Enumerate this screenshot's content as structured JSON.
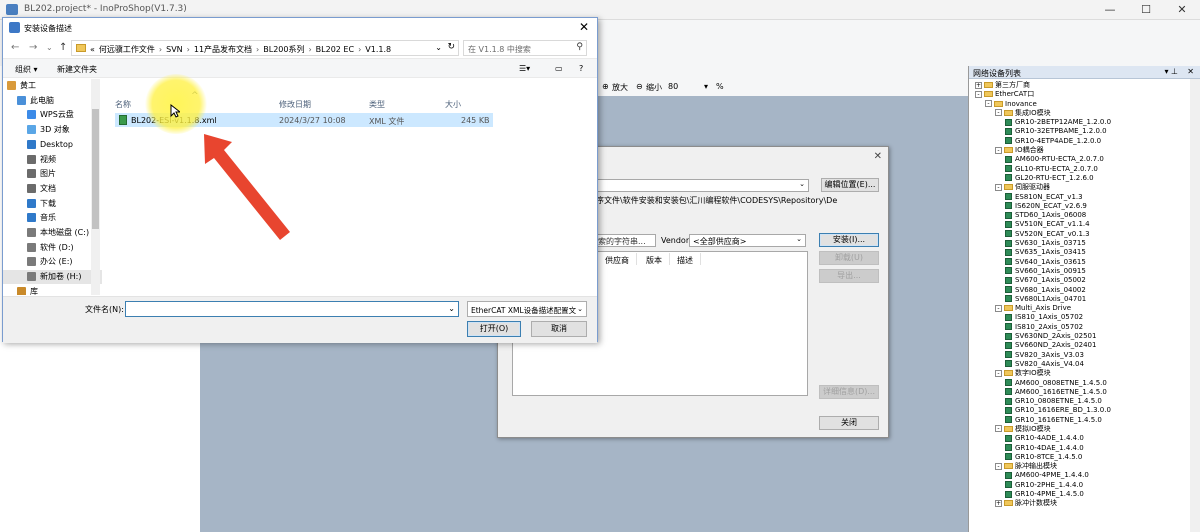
{
  "app": {
    "title": "BL202.project* - InoProShop(V1.7.3)",
    "min": "—",
    "max": "☐",
    "close": "✕"
  },
  "toolbar": {
    "zoom_in": "放大",
    "zoom_out": "缩小",
    "zoom_value": "80",
    "zoom_unit": "%"
  },
  "tree_panel": {
    "title": "网络设备列表",
    "pin": "▾ ⊥",
    "close": "✕",
    "rows": [
      {
        "level": 0,
        "type": "folder",
        "exp": "+",
        "label": "第三方厂商"
      },
      {
        "level": 0,
        "type": "folder",
        "exp": "-",
        "label": "EtherCAT口"
      },
      {
        "level": 1,
        "type": "folder",
        "exp": "-",
        "label": "Inovance"
      },
      {
        "level": 2,
        "type": "folder",
        "exp": "-",
        "label": "集成IO模块"
      },
      {
        "level": 3,
        "type": "device",
        "label": "GR10-2BETP12AME_1.2.0.0"
      },
      {
        "level": 3,
        "type": "device",
        "label": "GR10-32ETPBAME_1.2.0.0"
      },
      {
        "level": 3,
        "type": "device",
        "label": "GR10-4ETP4ADE_1.2.0.0"
      },
      {
        "level": 2,
        "type": "folder",
        "exp": "-",
        "label": "IO耦合器"
      },
      {
        "level": 3,
        "type": "device",
        "label": "AM600-RTU-ECTA_2.0.7.0"
      },
      {
        "level": 3,
        "type": "device",
        "label": "GL10-RTU-ECTA_2.0.7.0"
      },
      {
        "level": 3,
        "type": "device",
        "label": "GL20-RTU-ECT_1.2.6.0"
      },
      {
        "level": 2,
        "type": "folder",
        "exp": "-",
        "label": "伺服驱动器"
      },
      {
        "level": 3,
        "type": "device",
        "label": "ES810N_ECAT_v1.3"
      },
      {
        "level": 3,
        "type": "device",
        "label": "IS620N_ECAT_v2.6.9"
      },
      {
        "level": 3,
        "type": "device",
        "label": "STD60_1Axis_06008"
      },
      {
        "level": 3,
        "type": "device",
        "label": "SV510N_ECAT_v1.1.4"
      },
      {
        "level": 3,
        "type": "device",
        "label": "SV520N_ECAT_v0.1.3"
      },
      {
        "level": 3,
        "type": "device",
        "label": "SV630_1Axis_03715"
      },
      {
        "level": 3,
        "type": "device",
        "label": "SV635_1Axis_03415"
      },
      {
        "level": 3,
        "type": "device",
        "label": "SV640_1Axis_03615"
      },
      {
        "level": 3,
        "type": "device",
        "label": "SV660_1Axis_00915"
      },
      {
        "level": 3,
        "type": "device",
        "label": "SV670_1Axis_05002"
      },
      {
        "level": 3,
        "type": "device",
        "label": "SV680_1Axis_04002"
      },
      {
        "level": 3,
        "type": "device",
        "label": "SV680L1Axis_04701"
      },
      {
        "level": 2,
        "type": "folder",
        "exp": "-",
        "label": "Multi_Axis Drive"
      },
      {
        "level": 3,
        "type": "device",
        "label": "IS810_1Axis_05702"
      },
      {
        "level": 3,
        "type": "device",
        "label": "IS810_2Axis_05702"
      },
      {
        "level": 3,
        "type": "device",
        "label": "SV630ND_2Axis_02501"
      },
      {
        "level": 3,
        "type": "device",
        "label": "SV660ND_2Axis_02401"
      },
      {
        "level": 3,
        "type": "device",
        "label": "SV820_3Axis_V3.03"
      },
      {
        "level": 3,
        "type": "device",
        "label": "SV820_4Axis_V4.04"
      },
      {
        "level": 2,
        "type": "folder",
        "exp": "-",
        "label": "数字IO模块"
      },
      {
        "level": 3,
        "type": "device",
        "label": "AM600_0808ETNE_1.4.5.0"
      },
      {
        "level": 3,
        "type": "device",
        "label": "AM600_1616ETNE_1.4.5.0"
      },
      {
        "level": 3,
        "type": "device",
        "label": "GR10_0808ETNE_1.4.5.0"
      },
      {
        "level": 3,
        "type": "device",
        "label": "GR10_1616ERE_BD_1.3.0.0"
      },
      {
        "level": 3,
        "type": "device",
        "label": "GR10_1616ETNE_1.4.5.0"
      },
      {
        "level": 2,
        "type": "folder",
        "exp": "-",
        "label": "模拟IO模块"
      },
      {
        "level": 3,
        "type": "device",
        "label": "GR10-4ADE_1.4.4.0"
      },
      {
        "level": 3,
        "type": "device",
        "label": "GR10-4DAE_1.4.4.0"
      },
      {
        "level": 3,
        "type": "device",
        "label": "GR10-8TCE_1.4.5.0"
      },
      {
        "level": 2,
        "type": "folder",
        "exp": "-",
        "label": "脉冲输出模块"
      },
      {
        "level": 3,
        "type": "device",
        "label": "AM600-4PME_1.4.4.0"
      },
      {
        "level": 3,
        "type": "device",
        "label": "GR10-2PHE_1.4.4.0"
      },
      {
        "level": 3,
        "type": "device",
        "label": "GR10-4PME_1.4.5.0"
      },
      {
        "level": 2,
        "type": "folder",
        "exp": "+",
        "label": "脉冲计数模块"
      }
    ]
  },
  "repo_dialog": {
    "close": "✕",
    "location_value": "ory",
    "path_text": "序文件\\软件安装和安装包\\汇川编程软件\\CODESYS\\Repository\\De",
    "edit_location": "编辑位置(E)...",
    "search_placeholder": "索的字符串...",
    "vendor_label": "Vendor:",
    "vendor_value": "<全部供应商>",
    "install": "安装(I)...",
    "uninstall": "卸载(U)",
    "export": "导出...",
    "details": "详细信息(D)...",
    "close_button": "关闭",
    "columns": [
      "供应商",
      "版本",
      "描述"
    ]
  },
  "file_dialog": {
    "title": "安装设备描述",
    "close": "✕",
    "nav": {
      "back": "←",
      "forward": "→",
      "recent": "⌄",
      "up": "↑"
    },
    "breadcrumb": [
      "«",
      "何远骥工作文件",
      "SVN",
      "11产品发布文档",
      "BL200系列",
      "BL202 EC",
      "V1.1.8"
    ],
    "addr_dropdown": "⌄",
    "refresh": "↻",
    "search_placeholder": "在 V1.1.8 中搜索",
    "search_icon": "⚲",
    "organize": "组织 ▾",
    "new_folder": "新建文件夹",
    "view_label": "☰▾",
    "pane_label": "▭",
    "help_label": "?",
    "sidebar": [
      {
        "label": "黄工",
        "icon": "user-icon",
        "color": "#d99a3b"
      },
      {
        "label": "此电脑",
        "icon": "computer-icon",
        "color": "#4a90d9"
      },
      {
        "label": "WPS云盘",
        "icon": "cloud-icon",
        "color": "#3c8be8"
      },
      {
        "label": "3D 对象",
        "icon": "cube-icon",
        "color": "#5aa6e6"
      },
      {
        "label": "Desktop",
        "icon": "desktop-icon",
        "color": "#2f79c9"
      },
      {
        "label": "视频",
        "icon": "video-icon",
        "color": "#6b6b6b"
      },
      {
        "label": "图片",
        "icon": "picture-icon",
        "color": "#6b6b6b"
      },
      {
        "label": "文档",
        "icon": "document-icon",
        "color": "#6b6b6b"
      },
      {
        "label": "下载",
        "icon": "download-icon",
        "color": "#2f79c9"
      },
      {
        "label": "音乐",
        "icon": "music-icon",
        "color": "#2f79c9"
      },
      {
        "label": "本地磁盘 (C:)",
        "icon": "drive-icon",
        "color": "#7a7a7a"
      },
      {
        "label": "软件 (D:)",
        "icon": "drive-icon",
        "color": "#7a7a7a"
      },
      {
        "label": "办公 (E:)",
        "icon": "drive-icon",
        "color": "#7a7a7a"
      },
      {
        "label": "新加卷 (H:)",
        "icon": "drive-icon",
        "color": "#7a7a7a",
        "selected": true
      },
      {
        "label": "库",
        "icon": "library-icon",
        "color": "#c98a2a"
      }
    ],
    "columns": {
      "name": "名称",
      "modified": "修改日期",
      "type": "类型",
      "size": "大小"
    },
    "sort_indicator": "^",
    "files": [
      {
        "name": "BL202-ESI-v1.1.8.xml",
        "modified": "2024/3/27 10:08",
        "type": "XML 文件",
        "size": "245 KB"
      }
    ],
    "filename_label": "文件名(N):",
    "filename_value": "",
    "filetype_value": "EtherCAT XML设备描述配置文",
    "open_button": "打开(O)",
    "cancel_button": "取消"
  }
}
